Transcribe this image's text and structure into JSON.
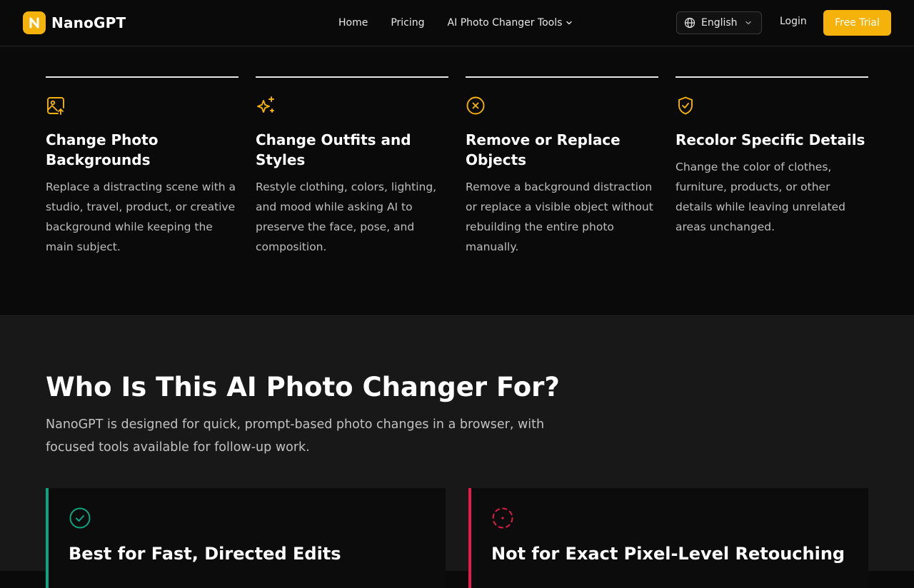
{
  "brand": {
    "name": "NanoGPT",
    "accent": "#f5b20a"
  },
  "nav": {
    "links": [
      {
        "label": "Home"
      },
      {
        "label": "Pricing"
      },
      {
        "label": "AI Photo Changer Tools"
      }
    ],
    "language": "English",
    "login": "Login",
    "cta": "Free Trial"
  },
  "features": [
    {
      "icon": "image-upload-icon",
      "title": "Change Photo Backgrounds",
      "desc": "Replace a distracting scene with a studio, travel, product, or creative background while keeping the main subject."
    },
    {
      "icon": "sparkles-icon",
      "title": "Change Outfits and Styles",
      "desc": "Restyle clothing, colors, lighting, and mood while asking AI to preserve the face, pose, and composition."
    },
    {
      "icon": "circle-x-icon",
      "title": "Remove or Replace Objects",
      "desc": "Remove a background distraction or replace a visible object without rebuilding the entire photo manually."
    },
    {
      "icon": "shield-check-icon",
      "title": "Recolor Specific Details",
      "desc": "Change the color of clothes, furniture, products, or other details while leaving unrelated areas unchanged."
    }
  ],
  "audience": {
    "heading": "Who Is This AI Photo Changer For?",
    "subheading": "NanoGPT is designed for quick, prompt-based photo changes in a browser, with focused tools available for follow-up work.",
    "cards": [
      {
        "icon": "circle-check-icon",
        "title": "Best for Fast, Directed Edits",
        "color": "#10a37f"
      },
      {
        "icon": "circle-dot-dashed-icon",
        "title": "Not for Exact Pixel-Level Retouching",
        "color": "#e11d48"
      }
    ]
  }
}
